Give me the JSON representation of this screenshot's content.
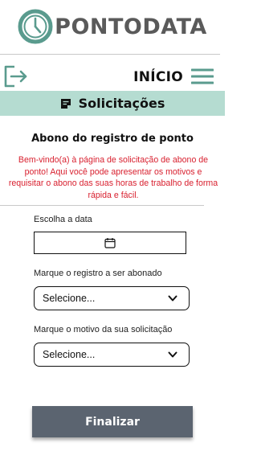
{
  "brand": {
    "name": "PONTODATA",
    "logo_icon": "clock-logo-icon"
  },
  "nav": {
    "logout_icon": "logout-icon",
    "home_label": "INÍCIO",
    "menu_icon": "hamburger-menu-icon"
  },
  "section": {
    "icon": "document-icon",
    "title": "Solicitações",
    "background": "#b5dcd1"
  },
  "page": {
    "title": "Abono do registro de ponto",
    "welcome": "Bem-vindo(a) à página de solicitação de abono de ponto! Aqui você pode apresentar os motivos e requisitar o abono das suas horas de trabalho de forma rápida e fácil."
  },
  "form": {
    "date_label": "Escolha a data",
    "date_value": "",
    "record_label": "Marque o registro a ser abonado",
    "record_selected": "Selecione...",
    "reason_label": "Marque o motivo da sua solicitação",
    "reason_selected": "Selecione...",
    "submit_label": "Finalizar"
  },
  "colors": {
    "accent_teal": "#5a9b8e",
    "warning_text": "#d81f2e",
    "button": "#5b6470"
  }
}
